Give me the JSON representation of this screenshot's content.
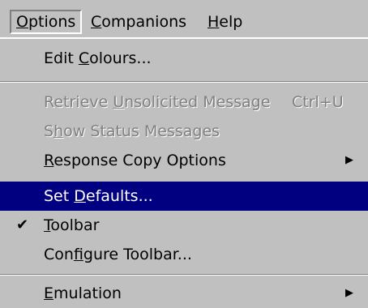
{
  "menubar": {
    "items": [
      {
        "label": "Options",
        "mnemonic": "O",
        "rest": "ptions"
      },
      {
        "label": "Companions",
        "mnemonic": "C",
        "rest": "ompanions"
      },
      {
        "label": "Help",
        "mnemonic": "H",
        "rest": "elp"
      }
    ]
  },
  "menu": {
    "edit_colours": {
      "pre": "Edit ",
      "mn": "C",
      "post": "olours..."
    },
    "retrieve": {
      "pre": "Retrieve ",
      "mn": "U",
      "post": "nsolicited Message",
      "shortcut": "Ctrl+U"
    },
    "show_status": {
      "pre": "S",
      "mn": "h",
      "post": "ow Status Messages"
    },
    "response_copy": {
      "pre": "",
      "mn": "R",
      "post": "esponse Copy Options",
      "arrow": "▶"
    },
    "set_defaults": {
      "pre": "Set ",
      "mn": "D",
      "post": "efaults..."
    },
    "toolbar": {
      "pre": "",
      "mn": "T",
      "post": "oolbar",
      "check": "✔"
    },
    "configure": {
      "pre": "Con",
      "mn": "f",
      "post": "igure Toolbar..."
    },
    "emulation": {
      "pre": "",
      "mn": "E",
      "post": "mulation",
      "arrow": "▶"
    }
  },
  "colors": {
    "selection": "#000080",
    "menu_bg": "#c0c0c0",
    "disabled": "#808080"
  }
}
